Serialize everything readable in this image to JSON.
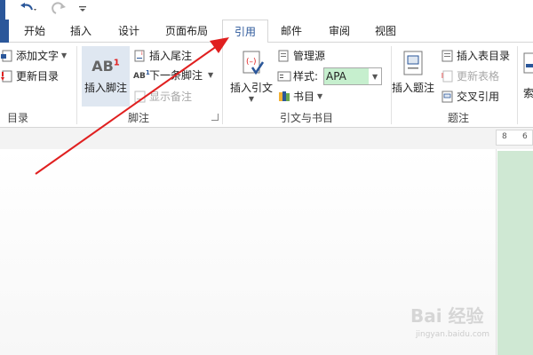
{
  "quick_access": {
    "undo_icon": "undo-icon",
    "redo_icon": "redo-icon",
    "customize_icon": "customize-qat-icon"
  },
  "tabs": [
    {
      "label": "开始"
    },
    {
      "label": "插入"
    },
    {
      "label": "设计"
    },
    {
      "label": "页面布局"
    },
    {
      "label": "引用"
    },
    {
      "label": "邮件"
    },
    {
      "label": "审阅"
    },
    {
      "label": "视图"
    }
  ],
  "active_tab": "引用",
  "ribbon": {
    "toc": {
      "add_text": "添加文字",
      "update_toc": "更新目录",
      "group_label": "目录"
    },
    "footnotes": {
      "insert_footnote": "插入脚注",
      "ab_glyph": "AB",
      "ab_sup": "1",
      "insert_endnote": "插入尾注",
      "next_footnote": "下一条脚注",
      "show_notes": "显示备注",
      "group_label": "脚注"
    },
    "citations": {
      "insert_citation": "插入引文",
      "manage_sources": "管理源",
      "style_label": "样式:",
      "style_value": "APA",
      "bibliography": "书目",
      "group_label": "引文与书目"
    },
    "captions": {
      "insert_caption": "插入题注",
      "insert_table_of_figures": "插入表目录",
      "update_table": "更新表格",
      "cross_reference": "交叉引用",
      "group_label": "题注"
    },
    "index": {
      "partial_label": "索"
    }
  },
  "ruler": {
    "ticks": [
      "8",
      "6"
    ]
  },
  "watermark": {
    "main": "Bai 经验",
    "sub": "jingyan.baidu.com"
  },
  "colors": {
    "accent": "#2b579a",
    "arrow": "#e02020",
    "style_field": "#c6efce",
    "page_green": "#cfe8d3"
  }
}
